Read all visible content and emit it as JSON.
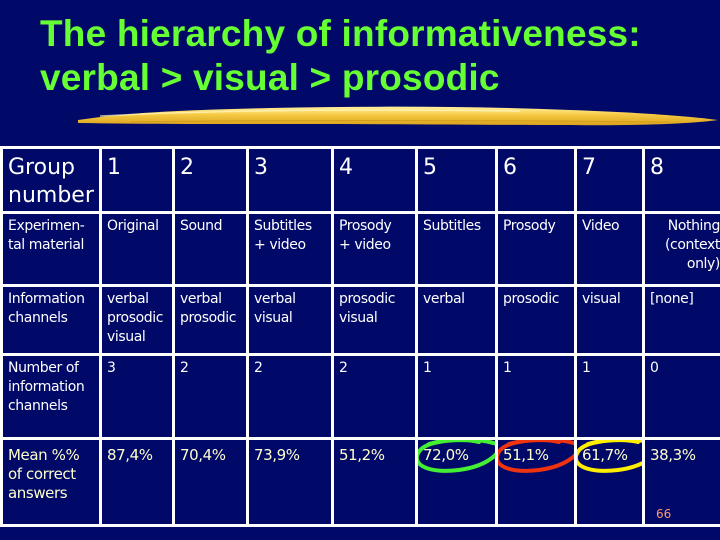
{
  "slide": {
    "title_line1": "The hierarchy of informativeness:",
    "title_line2": "verbal > visual > prosodic",
    "slide_number": "66",
    "colors": {
      "background": "#000868",
      "title": "#66ff33",
      "underline_stroke": "#f5c842",
      "table_text": "#ffffff",
      "mean_row_text": "#ffffcc",
      "grid_lines": "#ffffff",
      "slide_number": "#ff9966"
    }
  },
  "table": {
    "rows": [
      {
        "label": "Group\nnumber",
        "cells": [
          "1",
          "2",
          "3",
          "4",
          "5",
          "6",
          "7",
          "8"
        ]
      },
      {
        "label": "Experimen-\ntal material",
        "cells": [
          "Original",
          "Sound",
          "Subtitles\n+ video",
          "Prosody\n+ video",
          "Subtitles",
          "Prosody",
          "Video",
          "Nothing\n(context\nonly)"
        ]
      },
      {
        "label": "Information\nchannels",
        "cells": [
          "verbal\nprosodic\nvisual",
          "verbal\nprosodic",
          "verbal\n visual",
          "prosodic\nvisual",
          "verbal",
          "prosodic",
          "visual",
          "[none]"
        ]
      },
      {
        "label": "Number of\ninformation\nchannels",
        "cells": [
          "3",
          "2",
          "2",
          "2",
          "1",
          "1",
          "1",
          "0"
        ]
      },
      {
        "label": "Mean %%\nof correct\nanswers",
        "cells": [
          "87,4%",
          "70,4%",
          "73,9%",
          "51,2%",
          "72,0%",
          "51,1%",
          "61,7%",
          "38,3%"
        ]
      }
    ],
    "highlights": [
      {
        "column": 5,
        "value": "72,0%",
        "color": "#44ee33",
        "icon": "green-circle-annotation"
      },
      {
        "column": 6,
        "value": "51,1%",
        "color": "#ee3311",
        "icon": "red-circle-annotation"
      },
      {
        "column": 7,
        "value": "61,7%",
        "color": "#ffee00",
        "icon": "yellow-circle-annotation"
      }
    ]
  }
}
